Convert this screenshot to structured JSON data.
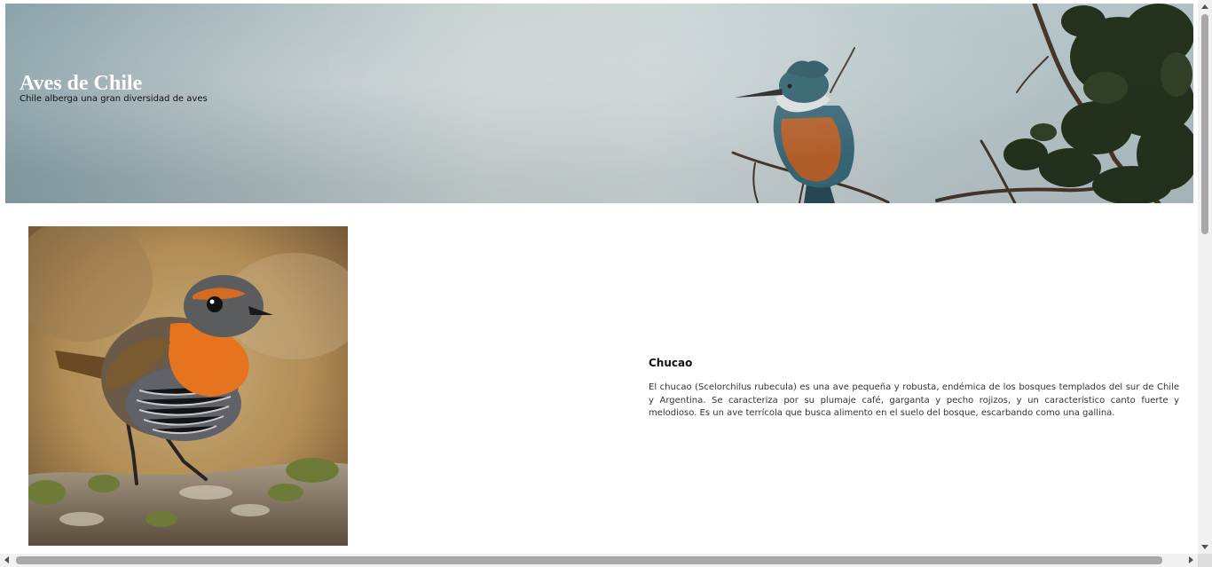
{
  "header": {
    "title": "Aves de Chile",
    "subtitle": "Chile alberga una gran diversidad de aves",
    "banner_image": "kingfisher-on-branch"
  },
  "bird": {
    "name": "Chucao",
    "description": "El chucao (Scelorchilus rubecula) es una ave pequeña y robusta, endémica de los bosques templados del sur de Chile y Argentina. Se caracteriza por su plumaje café, garganta y pecho rojizos, y un característico canto fuerte y melodioso. Es un ave terrícola que busca alimento en el suelo del bosque, escarbando como una gallina.",
    "image": "chucao-bird-photo"
  },
  "colors": {
    "banner_sky": "#c9d7da",
    "title_text": "#ffffff",
    "body_text": "#333333"
  }
}
